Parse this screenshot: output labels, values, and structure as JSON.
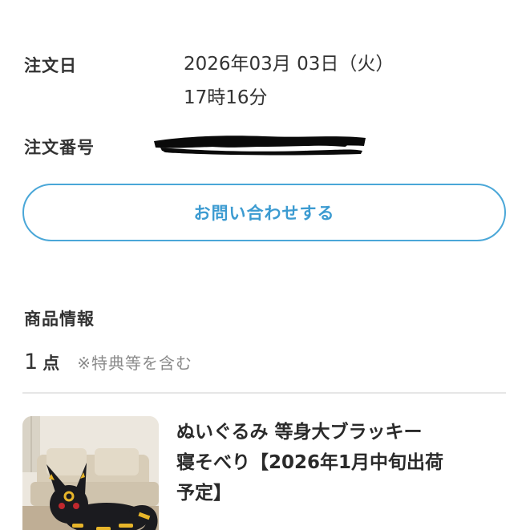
{
  "order": {
    "date_label": "注文日",
    "date_value_line1": "2026年03月 03日（火）",
    "date_value_line2": "17時16分",
    "number_label": "注文番号"
  },
  "contact_button": {
    "label": "お問い合わせする"
  },
  "product_section": {
    "heading": "商品情報",
    "count_number": "1",
    "count_unit": "点",
    "count_note": "※特典等を含む"
  },
  "product": {
    "name": "ぬいぐるみ 等身大ブラッキー\n寝そべり【2026年1月中旬出荷\n予定】"
  },
  "colors": {
    "accent": "#4aa7d8",
    "text": "#333333",
    "muted": "#8a8a8a",
    "divider": "#e6e6e6"
  }
}
